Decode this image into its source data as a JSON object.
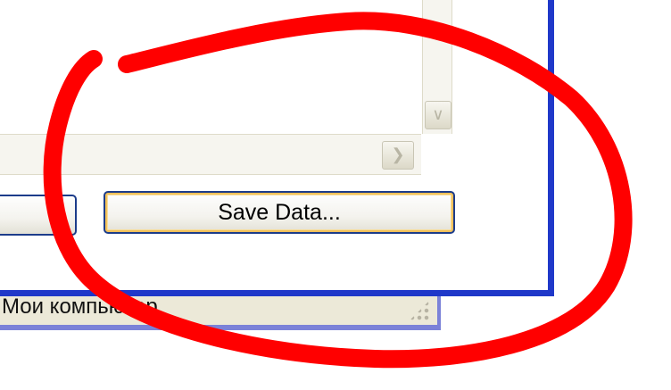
{
  "dialog": {
    "save_button_label": "Save Data...",
    "left_button_label": ""
  },
  "statusbar": {
    "text": "Мои компьютер"
  },
  "icons": {
    "scroll_down": "chevron-down-icon",
    "scroll_right": "chevron-right-icon"
  },
  "colors": {
    "annotation": "#ff0000",
    "window_border": "#1f38c9",
    "button_focus": "#f2c15a"
  }
}
